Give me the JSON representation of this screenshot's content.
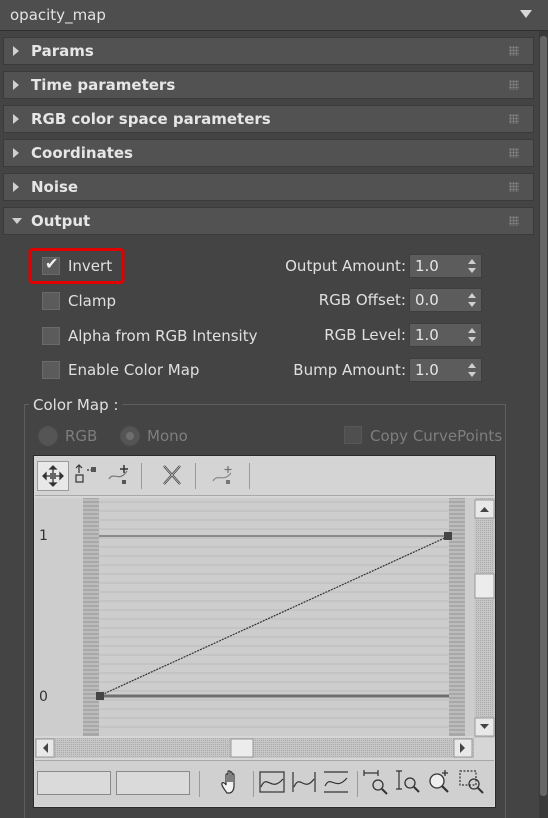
{
  "header": {
    "title": "opacity_map"
  },
  "rollouts": [
    {
      "label": "Params",
      "expanded": false
    },
    {
      "label": "Time parameters",
      "expanded": false
    },
    {
      "label": "RGB color space parameters",
      "expanded": false
    },
    {
      "label": "Coordinates",
      "expanded": false
    },
    {
      "label": "Noise",
      "expanded": false
    },
    {
      "label": "Output",
      "expanded": true
    }
  ],
  "output": {
    "checkboxes": [
      {
        "label": "Invert",
        "checked": true
      },
      {
        "label": "Clamp",
        "checked": false
      },
      {
        "label": "Alpha from RGB Intensity",
        "checked": false
      },
      {
        "label": "Enable Color Map",
        "checked": false
      }
    ],
    "spinners": [
      {
        "label": "Output Amount:",
        "value": "1.0"
      },
      {
        "label": "RGB Offset:",
        "value": "0.0"
      },
      {
        "label": "RGB Level:",
        "value": "1.0"
      },
      {
        "label": "Bump Amount:",
        "value": "1.0"
      }
    ]
  },
  "color_map": {
    "group_label": "Color Map :",
    "rgb_label": "RGB",
    "mono_label": "Mono",
    "mono_selected": true,
    "copy_label": "Copy CurvePoints",
    "y_ticks": [
      "1",
      "0"
    ],
    "curve": {
      "start": [
        0,
        0
      ],
      "end": [
        1,
        1
      ]
    },
    "toolbar_icons": [
      "move-point-icon",
      "scale-point-icon",
      "add-point-icon",
      "delete-point-icon",
      "reset-curves-icon"
    ],
    "bottom_icons": [
      "pan-hand-icon",
      "zoom-extents-icon",
      "zoom-horizontal-extents-icon",
      "zoom-vertical-extents-icon",
      "zoom-horizontal-icon",
      "zoom-vertical-icon",
      "zoom-icon",
      "zoom-region-icon"
    ],
    "highlight_color": "#e00000"
  }
}
